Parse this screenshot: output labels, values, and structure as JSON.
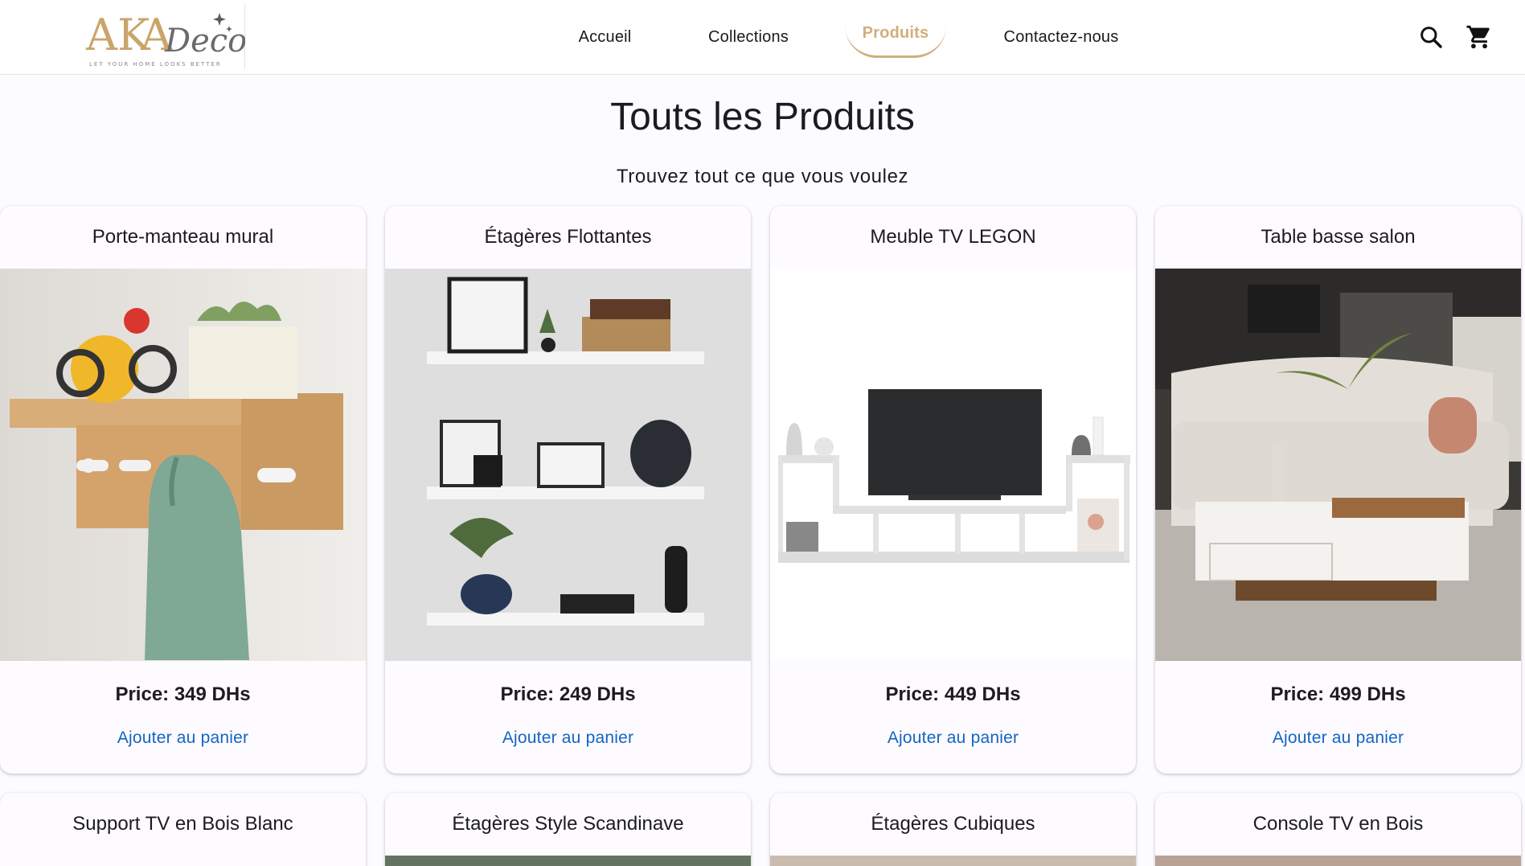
{
  "header": {
    "logo": {
      "text": "AKADeco",
      "tagline": "LET YOUR HOME LOOKS BETTER"
    },
    "nav": [
      {
        "label": "Accueil",
        "active": false
      },
      {
        "label": "Collections",
        "active": false
      },
      {
        "label": "Produits",
        "active": true
      },
      {
        "label": "Contactez-nous",
        "active": false
      }
    ],
    "icons": [
      "search-icon",
      "cart-icon"
    ]
  },
  "page": {
    "title": "Touts les Produits",
    "subtitle": "Trouvez tout ce que vous voulez"
  },
  "products": [
    {
      "name": "Porte-manteau mural",
      "price": "Price: 349 DHs",
      "button": "Ajouter au panier",
      "image": "wall-coat-rack-image"
    },
    {
      "name": "Étagères Flottantes",
      "price": "Price: 249 DHs",
      "button": "Ajouter au panier",
      "image": "floating-shelves-image"
    },
    {
      "name": "Meuble TV LEGON",
      "price": "Price: 449 DHs",
      "button": "Ajouter au panier",
      "image": "tv-unit-image"
    },
    {
      "name": "Table basse salon",
      "price": "Price: 499 DHs",
      "button": "Ajouter au panier",
      "image": "coffee-table-image"
    }
  ],
  "products_row2": [
    {
      "name": "Support TV en Bois Blanc",
      "image": "white-wood-tv-stand-image"
    },
    {
      "name": "Étagères Style Scandinave",
      "image": "scandinavian-shelves-image"
    },
    {
      "name": "Étagères Cubiques",
      "image": "cube-shelves-image"
    },
    {
      "name": "Console TV en Bois",
      "image": "wood-tv-console-image"
    }
  ],
  "colors": {
    "accent": "#d2ae7d",
    "link": "#1565c0",
    "background": "#fcfbfd",
    "text": "#1d1b20"
  }
}
